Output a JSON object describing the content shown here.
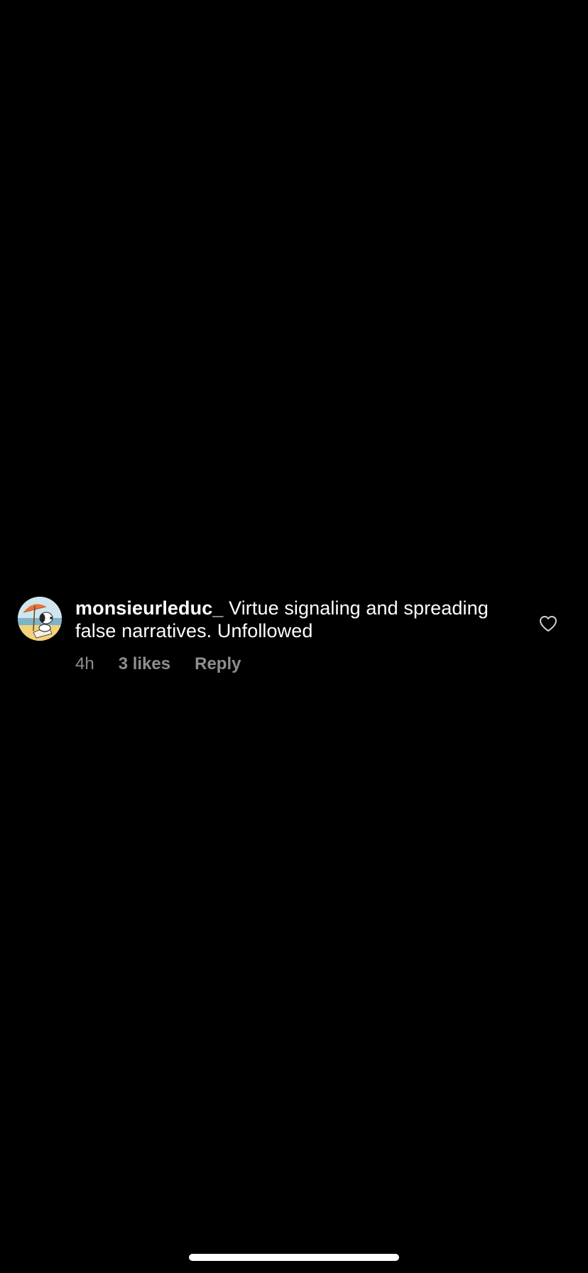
{
  "comment": {
    "username": "monsieurleduc_",
    "text": "Virtue signaling and spreading false narratives. Unfollowed",
    "time": "4h",
    "likes": "3 likes",
    "reply_label": "Reply",
    "avatar_icon": "snoopy-beach-avatar",
    "like_icon": "heart-outline-icon"
  },
  "colors": {
    "background": "#000000",
    "primary_text": "#ffffff",
    "secondary_text": "#8e8e8e"
  }
}
